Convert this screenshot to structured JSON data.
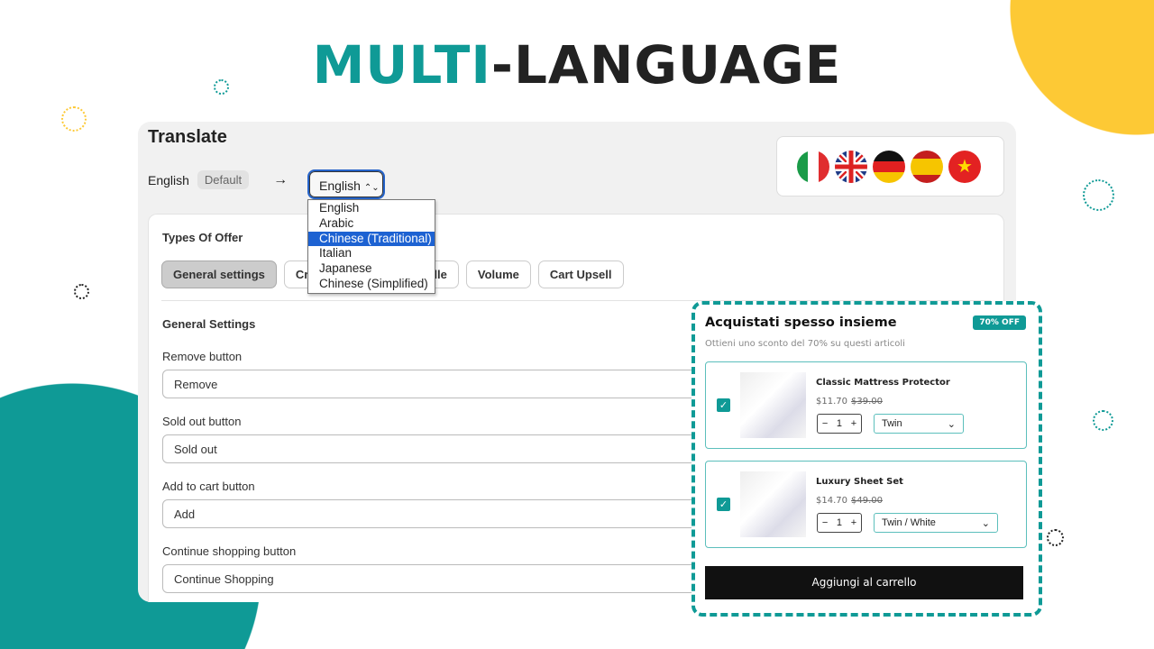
{
  "hero": {
    "accent": "MULTI",
    "rest": "-LANGUAGE"
  },
  "colors": {
    "teal": "#0f9a96",
    "yellow": "#fdc935",
    "select_highlight": "#1d62d2"
  },
  "translate": {
    "title": "Translate",
    "source_language": "English",
    "default_badge": "Default",
    "arrow_icon": "arrow-right",
    "target_select_value": "English",
    "dropdown_options": [
      "English",
      "Arabic",
      "Chinese (Traditional)",
      "Italian",
      "Japanese",
      "Chinese (Simplified)"
    ],
    "highlighted_option": "Chinese (Traditional)",
    "flags": [
      "italy",
      "united-kingdom",
      "germany",
      "spain",
      "vietnam"
    ],
    "types_label": "Types Of Offer",
    "tabs": [
      "General settings",
      "Cross",
      "dle",
      "Volume",
      "Cart Upsell"
    ],
    "section_title": "General Settings",
    "fields": [
      {
        "label": "Remove button",
        "value": "Remove"
      },
      {
        "label": "Sold out button",
        "value": "Sold out"
      },
      {
        "label": "Add to cart button",
        "value": "Add"
      },
      {
        "label": "Continue shopping button",
        "value": "Continue Shopping"
      }
    ]
  },
  "widget": {
    "title": "Acquistati spesso insieme",
    "badge": "70% OFF",
    "subtitle": "Ottieni uno sconto del 70% su questi articoli",
    "items": [
      {
        "name": "Classic Mattress Protector",
        "price": "$11.70",
        "compare": "$39.00",
        "qty": "1",
        "variant": "Twin",
        "checked": true
      },
      {
        "name": "Luxury Sheet Set",
        "price": "$14.70",
        "compare": "$49.00",
        "qty": "1",
        "variant": "Twin / White",
        "checked": true
      }
    ],
    "cta": "Aggiungi al carrello"
  }
}
